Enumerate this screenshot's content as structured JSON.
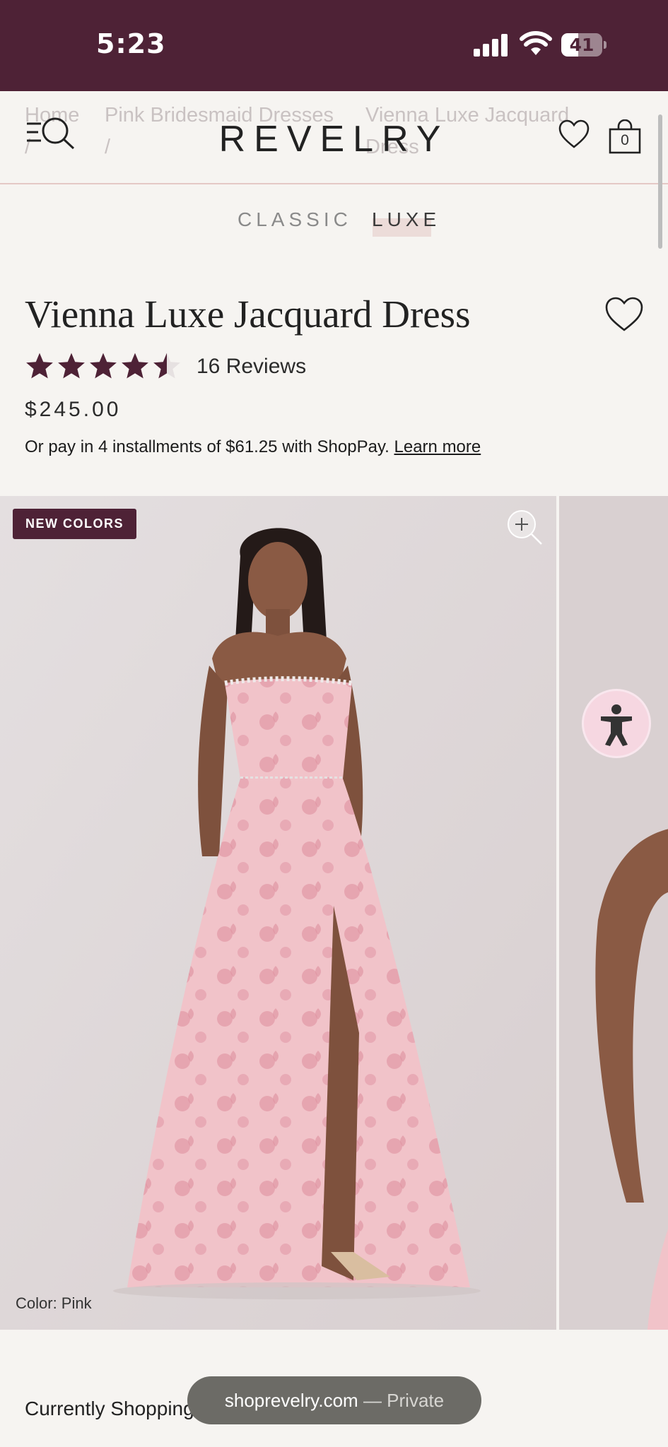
{
  "status_bar": {
    "time": "5:23",
    "battery": "41",
    "battery_fraction": 0.41
  },
  "header": {
    "logo": "REVELRY",
    "breadcrumbs": [
      "Home",
      "Pink Bridesmaid Dresses",
      "Vienna Luxe Jacquard Dress"
    ],
    "breadcrumb_separator": "/",
    "bag_count": "0"
  },
  "tabs": [
    {
      "label": "CLASSIC",
      "active": false
    },
    {
      "label": "LUXE",
      "active": true
    }
  ],
  "product": {
    "title": "Vienna Luxe Jacquard Dress",
    "rating": 4.5,
    "rating_max": 5,
    "reviews": "16 Reviews",
    "price": "$245.00",
    "installments_text": "Or pay in 4 installments of $61.25 with ShopPay.",
    "learn_more": "Learn more"
  },
  "gallery": {
    "badge": "NEW COLORS",
    "color_label": "Color: Pink"
  },
  "footer": {
    "currently_shopping": "Currently Shopping"
  },
  "browser": {
    "domain": "shoprevelry.com",
    "mode": "— Private"
  },
  "colors": {
    "brand": "#4e2236",
    "background": "#f6f4f1",
    "star": "#4e2236"
  }
}
